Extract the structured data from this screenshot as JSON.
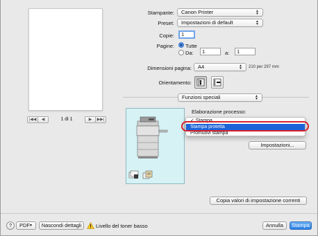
{
  "preview": {
    "page_label": "1 di 1"
  },
  "form": {
    "printer_label": "Stampante:",
    "printer_value": "Canon Printer",
    "preset_label": "Preset:",
    "preset_value": "Impostazioni di default",
    "copies_label": "Copie:",
    "copies_value": "1",
    "pages_label": "Pagine:",
    "pages_all": "Tutte",
    "pages_from": "Da:",
    "pages_from_value": "1",
    "pages_to": "a:",
    "pages_to_value": "1",
    "paper_size_label": "Dimensioni pagina:",
    "paper_size_value": "A4",
    "paper_size_note": "210 per 297 mm",
    "orientation_label": "Orientamento:",
    "section_popup": "Funzioni speciali"
  },
  "special": {
    "processing_label": "Elaborazione processo:",
    "menu_items": [
      "✓ Stampa",
      "Stampa protetta",
      "Promuovi stampa"
    ],
    "settings_button": "Impostazioni...",
    "copy_values_button": "Copia valori di impostazione correnti"
  },
  "footer": {
    "help": "?",
    "pdf_label": "PDF",
    "hide_details": "Nascondi dettagli",
    "toner_warning": "Livello del toner basso",
    "cancel": "Annulla",
    "print": "Stampa"
  },
  "icons": {
    "warning": "warning-triangle-icon",
    "portrait": "portrait-orientation-icon",
    "landscape": "landscape-orientation-icon"
  },
  "colors": {
    "selection": "#1d63d8",
    "highlight_ring": "#d6202b",
    "device_bg": "#d6f2f5",
    "primary_button": "#2a7ee3"
  }
}
